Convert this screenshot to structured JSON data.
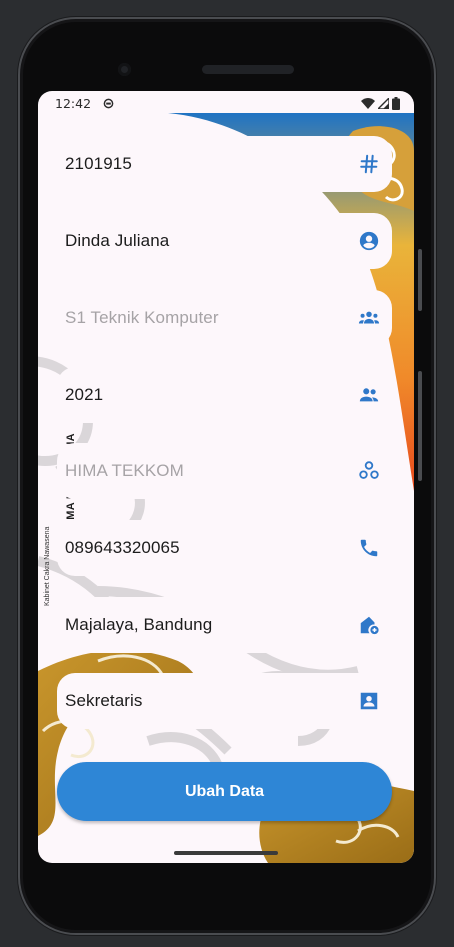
{
  "status_bar": {
    "time": "12:42"
  },
  "side_caption": "AMA NAWASENA",
  "side_caption_small": "Kabinet Cakra Nawasena",
  "fields": [
    {
      "value": "2101915",
      "muted": false,
      "icon": "hash-icon"
    },
    {
      "value": "Dinda Juliana",
      "muted": false,
      "icon": "account-circle-icon"
    },
    {
      "value": "S1 Teknik Komputer",
      "muted": true,
      "icon": "groups-icon"
    },
    {
      "value": "2021",
      "muted": false,
      "icon": "people-icon"
    },
    {
      "value": "HIMA TEKKOM",
      "muted": true,
      "icon": "workspaces-icon"
    },
    {
      "value": "089643320065",
      "muted": false,
      "icon": "phone-icon"
    },
    {
      "value": "Majalaya, Bandung",
      "muted": false,
      "icon": "add-home-icon"
    },
    {
      "value": "Sekretaris",
      "muted": false,
      "icon": "contact-card-icon"
    }
  ],
  "submit_button": {
    "label": "Ubah Data"
  },
  "colors": {
    "accent": "#2e86d6",
    "icon": "#2f78c9",
    "background": "#fdf7fb"
  }
}
